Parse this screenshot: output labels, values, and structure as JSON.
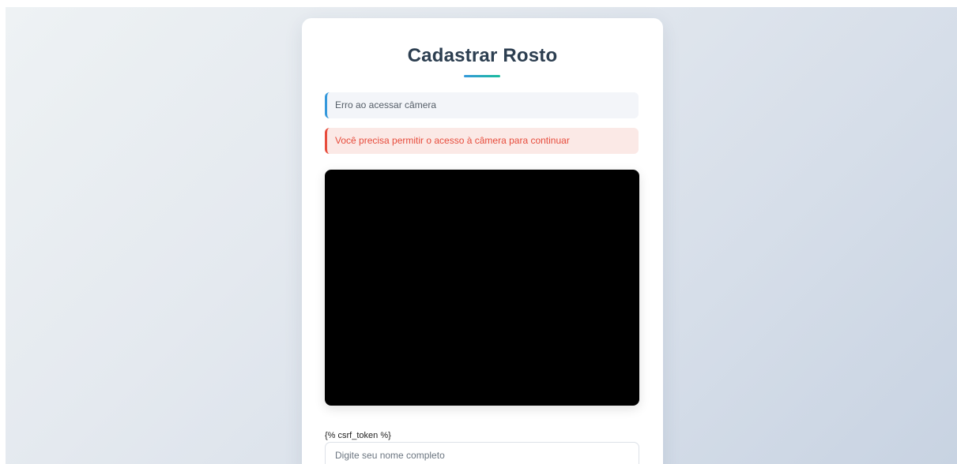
{
  "page": {
    "title": "Cadastrar Rosto"
  },
  "status": {
    "message": "Erro ao acessar câmera",
    "accent_color": "#3498db"
  },
  "error": {
    "message": "Você precisa permitir o acesso à câmera para continuar",
    "accent_color": "#e74c3c"
  },
  "camera": {
    "state": "black"
  },
  "form": {
    "csrf_text": "{% csrf_token %}",
    "name_placeholder": "Digite seu nome completo",
    "name_value": ""
  }
}
